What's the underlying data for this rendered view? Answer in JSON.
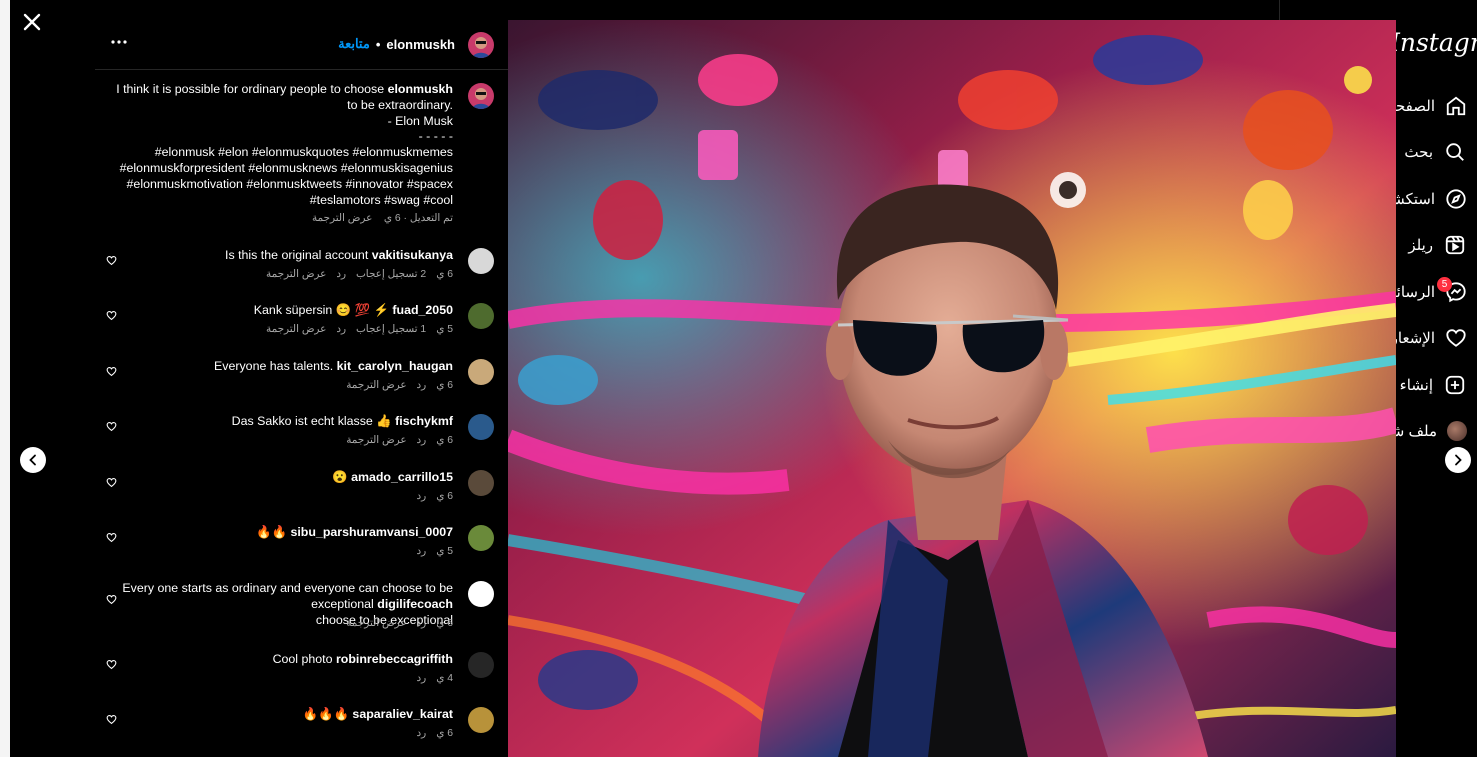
{
  "sidebar": {
    "logo": "Instagram",
    "items": [
      {
        "label": "الصفحة الرئيسية",
        "icon": "home-icon"
      },
      {
        "label": "بحث",
        "icon": "search-icon"
      },
      {
        "label": "استكشاف",
        "icon": "compass-icon"
      },
      {
        "label": "ريلز",
        "icon": "reels-icon"
      },
      {
        "label": "الرسائل",
        "icon": "messenger-icon"
      },
      {
        "label": "الإشعارات",
        "icon": "heart-icon"
      },
      {
        "label": "إنشاء",
        "icon": "create-icon"
      },
      {
        "label": "ملف شخصي",
        "icon": "profile-avatar"
      }
    ],
    "messages_badge": "5"
  },
  "post": {
    "username": "elonmuskh",
    "follow_label": "متابعة",
    "caption_username": "elonmuskh",
    "caption_lines": [
      "I think it is possible for ordinary people to choose",
      "to be extraordinary.",
      "- Elon Musk",
      "- - - - -",
      "#elonmusk #elon #elonmuskquotes #elonmuskmemes",
      "#elonmuskforpresident #elonmusknews #elonmuskisagenius",
      "#elonmuskmotivation #elonmusktweets #innovator #spacex",
      "#teslamotors #swag #cool"
    ],
    "caption_meta": "تم التعديل · 6 ي    عرض الترجمة"
  },
  "comments": [
    {
      "user": "vakitisukanya",
      "text": "Is this the original account",
      "meta": [
        "6 ي",
        "2 تسجيل إعجاب",
        "رد",
        "عرض الترجمة"
      ],
      "avatar_color": "#d8d8d8"
    },
    {
      "user": "fuad_2050",
      "text": "Kank süpersin 😊 💯 ⚡",
      "meta": [
        "5 ي",
        "1 تسجيل إعجاب",
        "رد",
        "عرض الترجمة"
      ],
      "avatar_color": "#4e6b2e"
    },
    {
      "user": "kit_carolyn_haugan",
      "text": "Everyone has talents.",
      "meta": [
        "6 ي",
        "رد",
        "عرض الترجمة"
      ],
      "avatar_color": "#c9a97a"
    },
    {
      "user": "fischykmf",
      "text": "Das Sakko ist echt klasse 👍",
      "meta": [
        "6 ي",
        "رد",
        "عرض الترجمة"
      ],
      "avatar_color": "#2a5a8c"
    },
    {
      "user": "amado_carrillo15",
      "text": "😮",
      "meta": [
        "6 ي",
        "رد"
      ],
      "avatar_color": "#5a4a3a"
    },
    {
      "user": "sibu_parshuramvansi_0007",
      "text": "🔥🔥",
      "meta": [
        "5 ي",
        "رد"
      ],
      "avatar_color": "#6a8a3a"
    },
    {
      "user": "digilifecoach",
      "text": "Every one starts as ordinary and everyone can\nchoose to be exceptional",
      "meta": [
        "6 ي",
        "رد",
        "عرض الترجمة"
      ],
      "avatar_color": "#ffffff"
    },
    {
      "user": "robinrebeccagriffith",
      "text": "Cool photo",
      "meta": [
        "4 ي",
        "رد"
      ],
      "avatar_color": "#262626"
    },
    {
      "user": "saparaliev_kairat",
      "text": "🔥🔥🔥",
      "meta": [
        "6 ي",
        "رد"
      ],
      "avatar_color": "#b8923a"
    }
  ]
}
